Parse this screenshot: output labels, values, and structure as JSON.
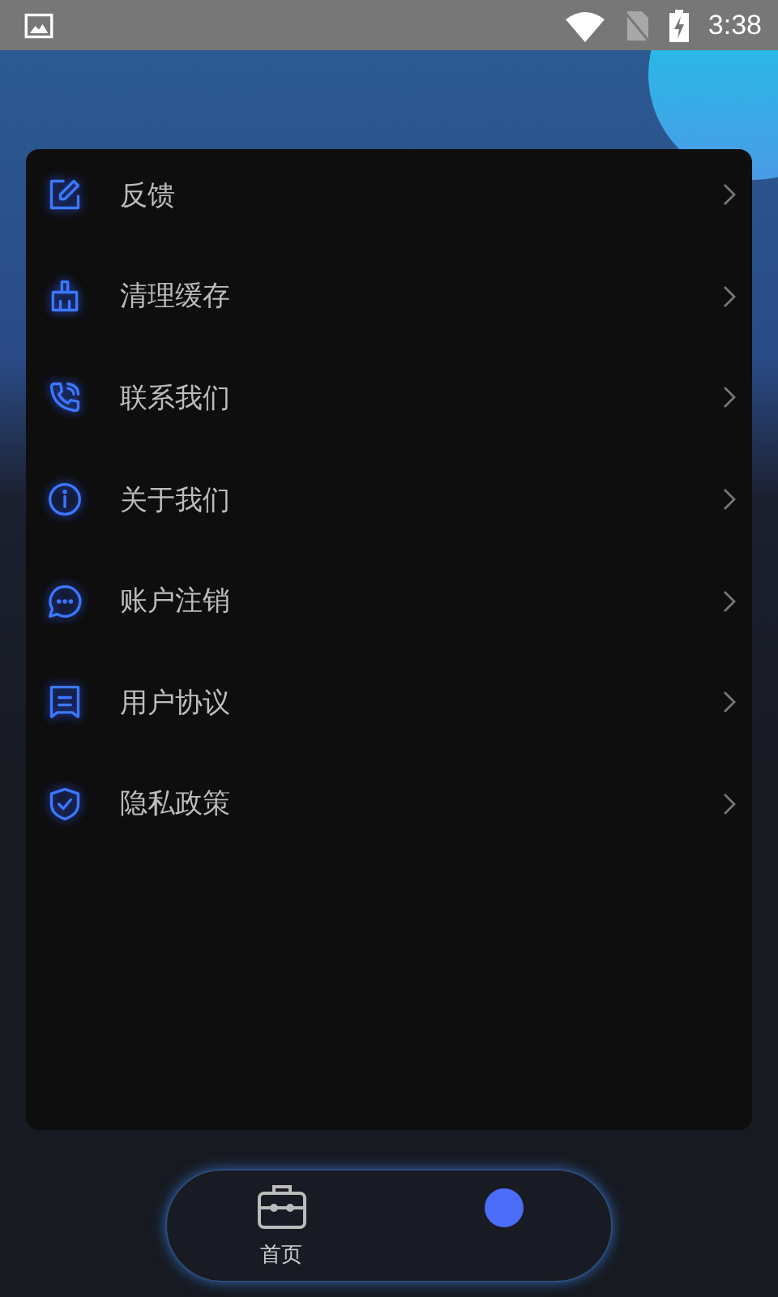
{
  "status_bar": {
    "time": "3:38"
  },
  "menu": [
    {
      "label": "反馈",
      "kind": "edit"
    },
    {
      "label": "清理缓存",
      "kind": "broom"
    },
    {
      "label": "联系我们",
      "kind": "phone"
    },
    {
      "label": "关于我们",
      "kind": "info"
    },
    {
      "label": "账户注销",
      "kind": "chat"
    },
    {
      "label": "用户协议",
      "kind": "doc"
    },
    {
      "label": "隐私政策",
      "kind": "shield"
    }
  ],
  "tabs": [
    {
      "label": "首页",
      "selected": false
    },
    {
      "selected": true
    }
  ]
}
